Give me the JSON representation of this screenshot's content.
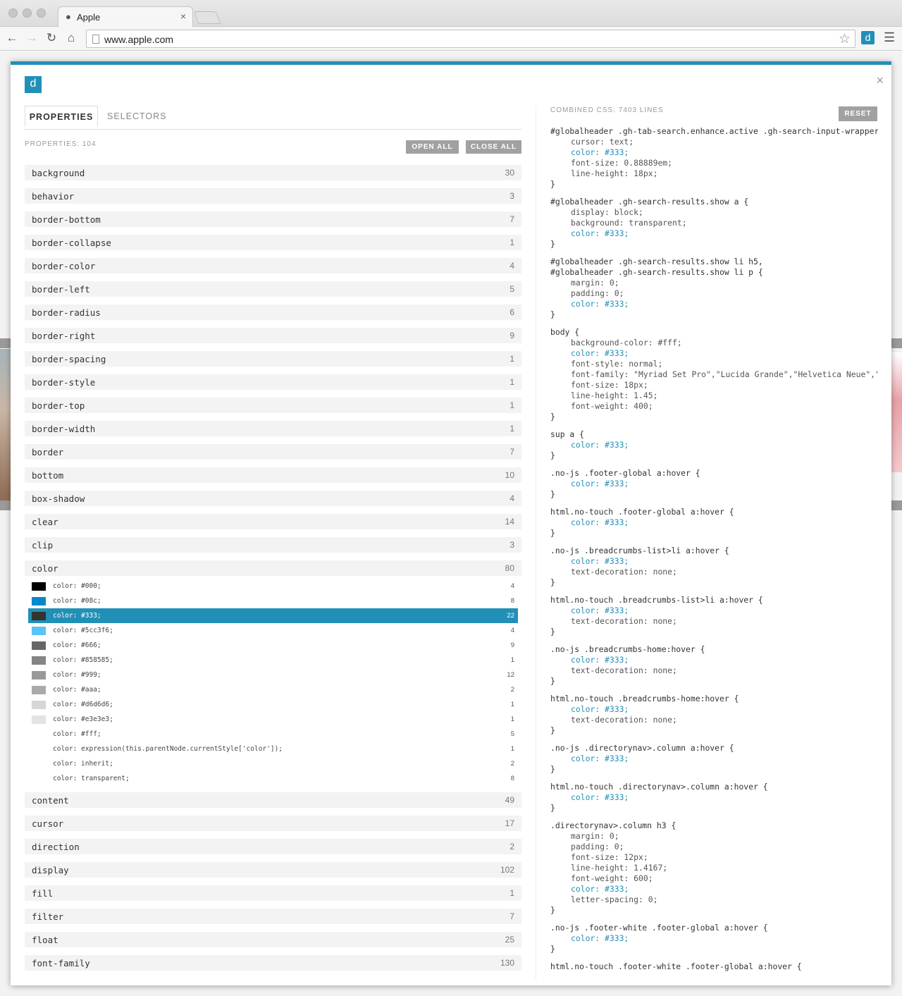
{
  "browser": {
    "tab_title": "Apple",
    "tab_icon": "apple-icon",
    "url": "www.apple.com",
    "extension_label": "d"
  },
  "panel": {
    "logo": "d",
    "close_glyph": "×",
    "tabs": [
      "PROPERTIES",
      "SELECTORS"
    ],
    "properties_count": "PROPERTIES: 104",
    "open_all": "OPEN ALL",
    "close_all": "CLOSE ALL",
    "combined_css": "COMBINED CSS: 7403 LINES",
    "reset": "RESET"
  },
  "properties_before": [
    {
      "name": "background",
      "count": "30"
    },
    {
      "name": "behavior",
      "count": "3"
    },
    {
      "name": "border-bottom",
      "count": "7"
    },
    {
      "name": "border-collapse",
      "count": "1"
    },
    {
      "name": "border-color",
      "count": "4"
    },
    {
      "name": "border-left",
      "count": "5"
    },
    {
      "name": "border-radius",
      "count": "6"
    },
    {
      "name": "border-right",
      "count": "9"
    },
    {
      "name": "border-spacing",
      "count": "1"
    },
    {
      "name": "border-style",
      "count": "1"
    },
    {
      "name": "border-top",
      "count": "1"
    },
    {
      "name": "border-width",
      "count": "1"
    },
    {
      "name": "border",
      "count": "7"
    },
    {
      "name": "bottom",
      "count": "10"
    },
    {
      "name": "box-shadow",
      "count": "4"
    },
    {
      "name": "clear",
      "count": "14"
    },
    {
      "name": "clip",
      "count": "3"
    }
  ],
  "expanded_property": {
    "name": "color",
    "count": "80"
  },
  "color_values": [
    {
      "value": "color: #000;",
      "count": "4",
      "swatch": "#000000"
    },
    {
      "value": "color: #08c;",
      "count": "8",
      "swatch": "#0088cc"
    },
    {
      "value": "color: #333;",
      "count": "22",
      "swatch": "#333333",
      "selected": true
    },
    {
      "value": "color: #5cc3f6;",
      "count": "4",
      "swatch": "#5cc3f6"
    },
    {
      "value": "color: #666;",
      "count": "9",
      "swatch": "#666666"
    },
    {
      "value": "color: #858585;",
      "count": "1",
      "swatch": "#858585"
    },
    {
      "value": "color: #999;",
      "count": "12",
      "swatch": "#999999"
    },
    {
      "value": "color: #aaa;",
      "count": "2",
      "swatch": "#aaaaaa"
    },
    {
      "value": "color: #d6d6d6;",
      "count": "1",
      "swatch": "#d6d6d6"
    },
    {
      "value": "color: #e3e3e3;",
      "count": "1",
      "swatch": "#e3e3e3"
    },
    {
      "value": "color: #fff;",
      "count": "5",
      "swatch": ""
    },
    {
      "value": "color: expression(this.parentNode.currentStyle['color']);",
      "count": "1",
      "swatch": ""
    },
    {
      "value": "color: inherit;",
      "count": "2",
      "swatch": ""
    },
    {
      "value": "color: transparent;",
      "count": "8",
      "swatch": ""
    }
  ],
  "properties_after": [
    {
      "name": "content",
      "count": "49"
    },
    {
      "name": "cursor",
      "count": "17"
    },
    {
      "name": "direction",
      "count": "2"
    },
    {
      "name": "display",
      "count": "102"
    },
    {
      "name": "fill",
      "count": "1"
    },
    {
      "name": "filter",
      "count": "7"
    },
    {
      "name": "float",
      "count": "25"
    },
    {
      "name": "font-family",
      "count": "130"
    }
  ],
  "css_blocks": [
    {
      "selectors": [
        "#globalheader .gh-tab-search.enhance.active .gh-search-input-wrapper"
      ],
      "decls": [
        "cursor: text;",
        "color: #333;",
        "font-size: 0.88889em;",
        "line-height: 18px;"
      ]
    },
    {
      "selectors": [
        "#globalheader .gh-search-results.show a {"
      ],
      "decls": [
        "display: block;",
        "background: transparent;",
        "color: #333;"
      ]
    },
    {
      "selectors": [
        "#globalheader .gh-search-results.show li h5,",
        "#globalheader .gh-search-results.show li p {"
      ],
      "decls": [
        "margin: 0;",
        "padding: 0;",
        "color: #333;"
      ]
    },
    {
      "selectors": [
        "body {"
      ],
      "decls": [
        "background-color: #fff;",
        "color: #333;",
        "font-style: normal;",
        "font-family: \"Myriad Set Pro\",\"Lucida Grande\",\"Helvetica Neue\",\"Helvetica\"",
        "font-size: 18px;",
        "line-height: 1.45;",
        "font-weight: 400;"
      ]
    },
    {
      "selectors": [
        "sup a {"
      ],
      "decls": [
        "color: #333;"
      ]
    },
    {
      "selectors": [
        ".no-js .footer-global a:hover {"
      ],
      "decls": [
        "color: #333;"
      ]
    },
    {
      "selectors": [
        "html.no-touch .footer-global a:hover {"
      ],
      "decls": [
        "color: #333;"
      ]
    },
    {
      "selectors": [
        ".no-js .breadcrumbs-list>li a:hover {"
      ],
      "decls": [
        "color: #333;",
        "text-decoration: none;"
      ]
    },
    {
      "selectors": [
        "html.no-touch .breadcrumbs-list>li a:hover {"
      ],
      "decls": [
        "color: #333;",
        "text-decoration: none;"
      ]
    },
    {
      "selectors": [
        ".no-js .breadcrumbs-home:hover {"
      ],
      "decls": [
        "color: #333;",
        "text-decoration: none;"
      ]
    },
    {
      "selectors": [
        "html.no-touch .breadcrumbs-home:hover {"
      ],
      "decls": [
        "color: #333;",
        "text-decoration: none;"
      ]
    },
    {
      "selectors": [
        ".no-js .directorynav>.column a:hover {"
      ],
      "decls": [
        "color: #333;"
      ]
    },
    {
      "selectors": [
        "html.no-touch .directorynav>.column a:hover {"
      ],
      "decls": [
        "color: #333;"
      ]
    },
    {
      "selectors": [
        ".directorynav>.column h3 {"
      ],
      "decls": [
        "margin: 0;",
        "padding: 0;",
        "font-size: 12px;",
        "line-height: 1.4167;",
        "font-weight: 600;",
        "color: #333;",
        "letter-spacing: 0;"
      ]
    },
    {
      "selectors": [
        ".no-js .footer-white .footer-global a:hover {"
      ],
      "decls": [
        "color: #333;"
      ]
    },
    {
      "selectors": [
        "html.no-touch .footer-white .footer-global a:hover {"
      ],
      "decls": []
    }
  ],
  "highlight_decl": "color: #333;",
  "accent_color": "#2290b6"
}
